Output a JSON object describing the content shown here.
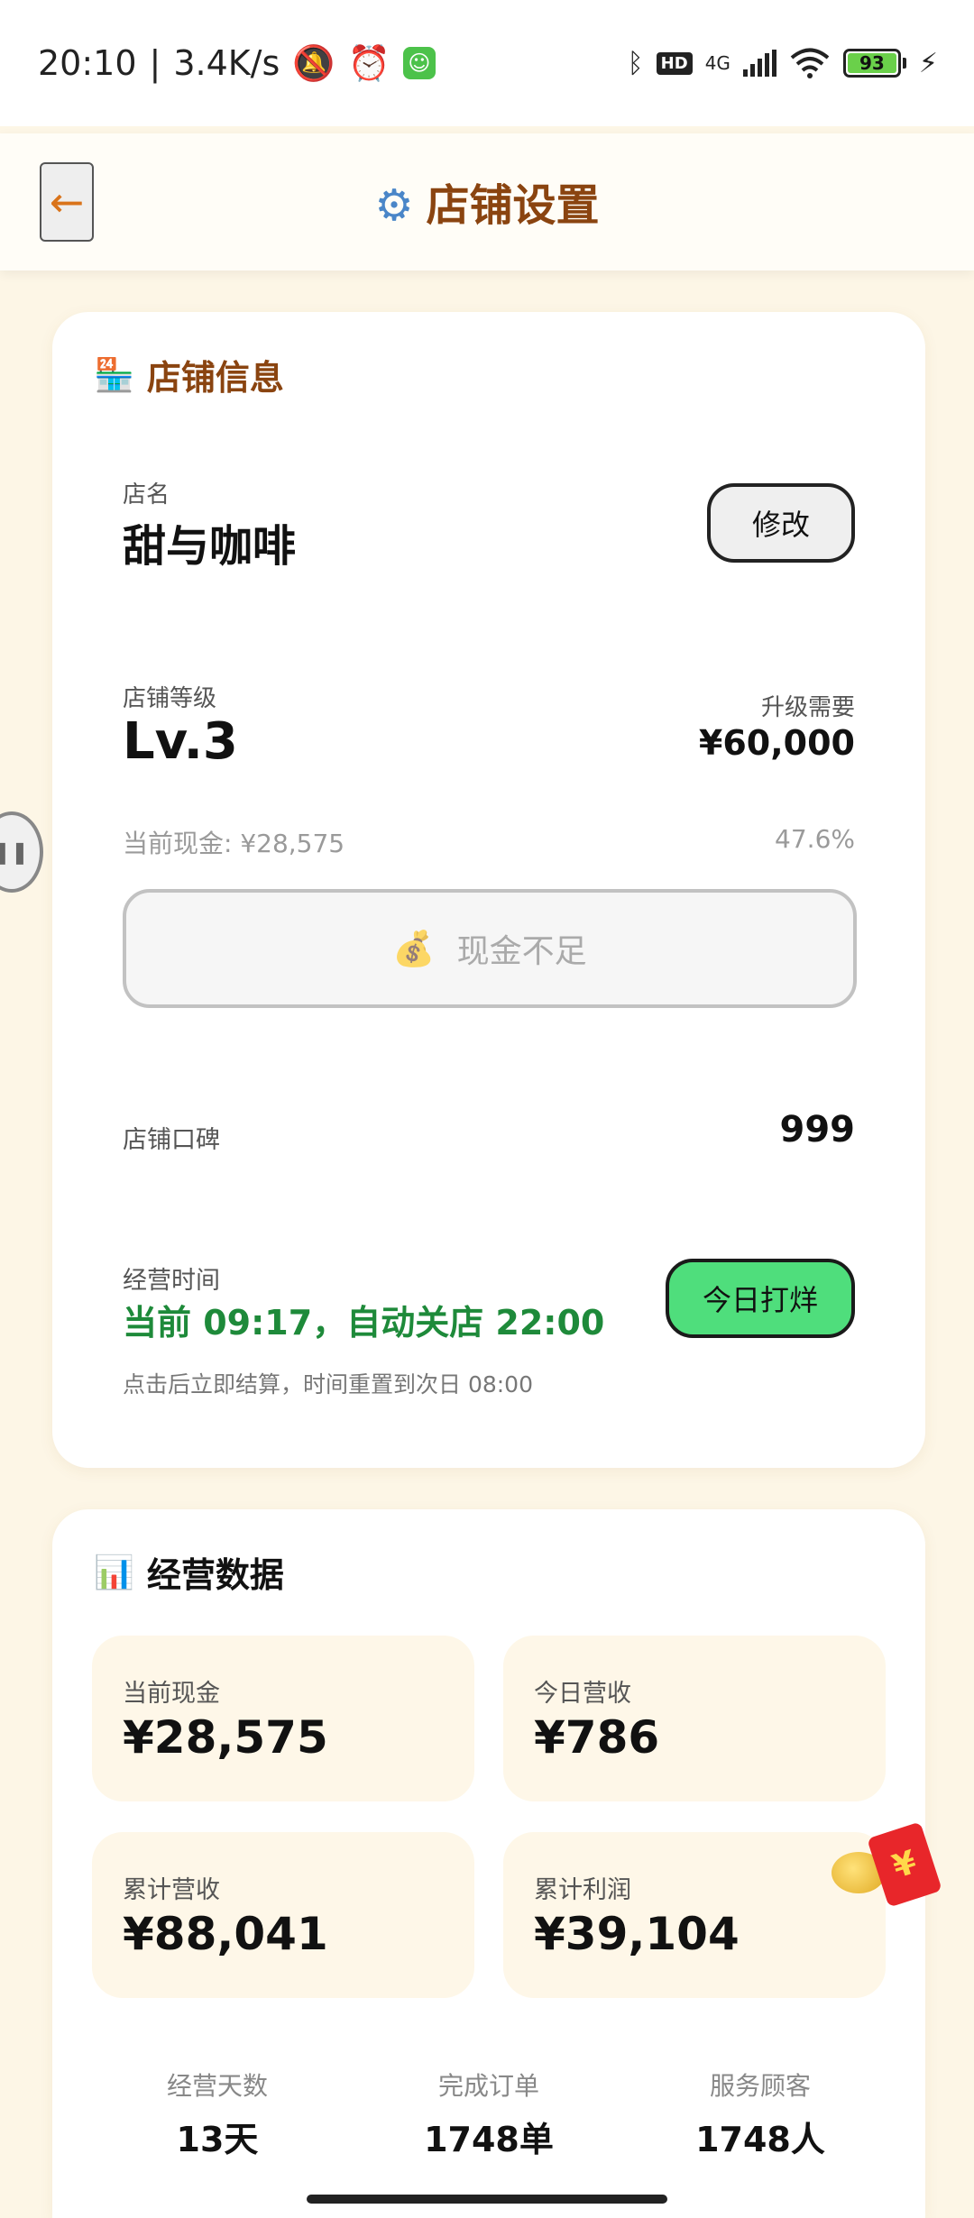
{
  "status_bar": {
    "time": "20:10",
    "speed": "3.4K/s",
    "network": "4G",
    "battery": "93"
  },
  "header": {
    "back_glyph": "←",
    "title": "店铺设置"
  },
  "shop_info": {
    "section_title": "店铺信息",
    "name_label": "店名",
    "name_value": "甜与咖啡",
    "edit_button": "修改",
    "level_label": "店铺等级",
    "level_value": "Lv.3",
    "upgrade_label": "升级需要",
    "upgrade_value": "¥60,000",
    "current_cash_text": "当前现金: ¥28,575",
    "progress_text": "47.6%",
    "cash_button": "现金不足",
    "reputation_label": "店铺口碑",
    "reputation_value": "999",
    "hours_label": "经营时间",
    "hours_value": "当前 09:17，自动关店 22:00",
    "close_button": "今日打烊",
    "hours_hint": "点击后立即结算，时间重置到次日 08:00"
  },
  "business_data": {
    "section_title": "经营数据",
    "stats": [
      {
        "label": "当前现金",
        "value": "¥28,575"
      },
      {
        "label": "今日营收",
        "value": "¥786"
      },
      {
        "label": "累计营收",
        "value": "¥88,041"
      },
      {
        "label": "累计利润",
        "value": "¥39,104"
      }
    ],
    "mini_stats": [
      {
        "label": "经营天数",
        "value": "13天"
      },
      {
        "label": "完成订单",
        "value": "1748单"
      },
      {
        "label": "服务顾客",
        "value": "1748人"
      }
    ]
  },
  "icons": {
    "gear": "gear-icon",
    "store": "store-icon",
    "chart": "bar-chart-icon",
    "money_bag": "money-bag-icon",
    "red_packet": "red-packet-icon"
  },
  "colors": {
    "accent_brown": "#8a4410",
    "success_green": "#1e8a3a",
    "button_green": "#4fde7c",
    "background": "#fdf6e6"
  }
}
